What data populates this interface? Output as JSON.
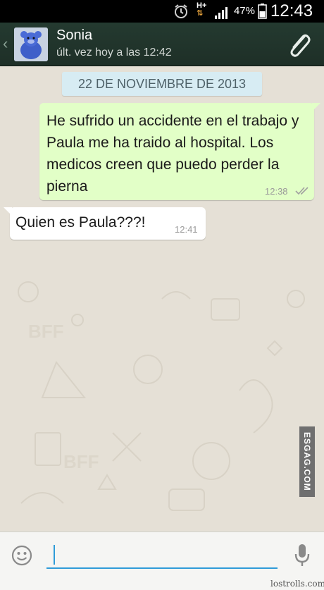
{
  "status_bar": {
    "network": "H+",
    "battery_percent": "47%",
    "clock": "12:43",
    "icons": [
      "alarm-icon",
      "data-arrows-icon",
      "signal-icon",
      "battery-icon"
    ]
  },
  "header": {
    "contact_name": "Sonia",
    "last_seen": "últ. vez hoy a las 12:42",
    "icons": [
      "back-chevron-icon",
      "avatar",
      "paperclip-icon"
    ]
  },
  "chat": {
    "date_divider": "22 DE NOVIEMBRE DE 2013",
    "messages": [
      {
        "direction": "outgoing",
        "text": "He sufrido un accidente en el trabajo y Paula me ha traido al hospital. Los medicos creen que puedo perder la pierna",
        "time": "12:38",
        "status": "read-double-check"
      },
      {
        "direction": "incoming",
        "text": "Quien es Paula???!",
        "time": "12:41"
      }
    ]
  },
  "watermark": "ESGAG.COM",
  "input_bar": {
    "value": "",
    "icons": [
      "emoji-icon",
      "microphone-icon"
    ]
  },
  "footer": {
    "credit": "lostrolls.com"
  },
  "colors": {
    "header_bg": "#22362d",
    "outgoing_bubble": "#e2ffc7",
    "incoming_bubble": "#ffffff",
    "date_chip": "#d7ecf3",
    "chat_bg": "#e5e0d6",
    "input_accent": "#2f9bd8"
  }
}
